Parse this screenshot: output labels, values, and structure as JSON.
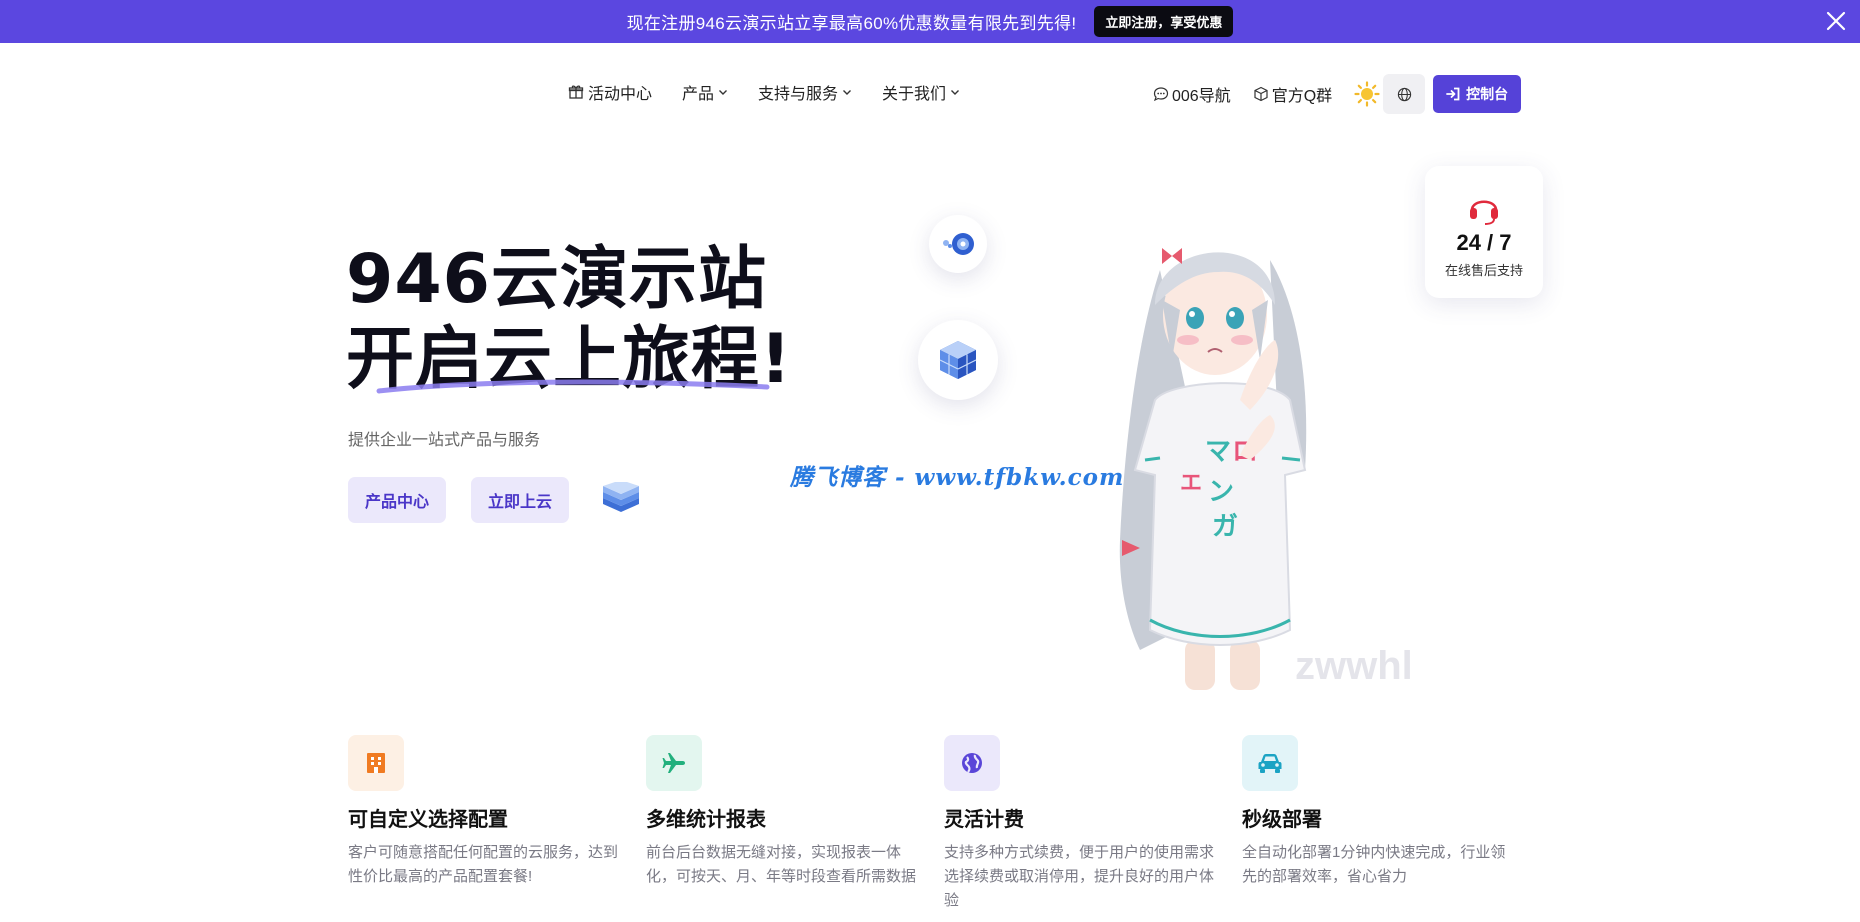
{
  "promo": {
    "text": "现在注册946云演示站立享最高60%优惠数量有限先到先得!",
    "button": "立即注册，享受优惠"
  },
  "nav": {
    "items": [
      {
        "label": "活动中心",
        "icon": "gift-icon"
      },
      {
        "label": "产品",
        "icon": "chevron-down-icon"
      },
      {
        "label": "支持与服务",
        "icon": "chevron-down-icon"
      },
      {
        "label": "关于我们",
        "icon": "chevron-down-icon"
      }
    ],
    "right": [
      {
        "label": "006导航",
        "icon": "chat-icon"
      },
      {
        "label": "官方Q群",
        "icon": "cube-icon"
      }
    ],
    "console_label": "控制台"
  },
  "hero": {
    "title_line1": "946云演示站",
    "title_line2": "开启云上旅程!",
    "subtitle": "提供企业一站式产品与服务",
    "btn_products": "产品中心",
    "btn_cloud": "立即上云"
  },
  "watermarks": {
    "blue": "腾飞博客 - www.tfbkw.com",
    "gray": "zwwhl"
  },
  "support": {
    "value": "24 / 7",
    "label": "在线售后支持"
  },
  "features": [
    {
      "title": "可自定义选择配置",
      "desc": "客户可随意搭配任何配置的云服务，达到性价比最高的产品配置套餐!",
      "icon": "building-icon",
      "color": "#f07b22",
      "bg": "#fdf0e4"
    },
    {
      "title": "多维统计报表",
      "desc": "前台后台数据无缝对接，实现报表一体化，可按天、月、年等时段查看所需数据",
      "icon": "plane-icon",
      "color": "#22b07d",
      "bg": "#e3f6ef"
    },
    {
      "title": "灵活计费",
      "desc": "支持多种方式续费，便于用户的使用需求选择续费或取消停用，提升良好的用户体验",
      "icon": "globe-icon",
      "color": "#5a46d8",
      "bg": "#ebe8fb"
    },
    {
      "title": "秒级部署",
      "desc": "全自动化部署1分钟内快速完成，行业领先的部署效率，省心省力",
      "icon": "car-icon",
      "color": "#1ba3c4",
      "bg": "#e2f4f8"
    }
  ],
  "colors": {
    "accent": "#5b47e0",
    "console": "#5542d8"
  }
}
